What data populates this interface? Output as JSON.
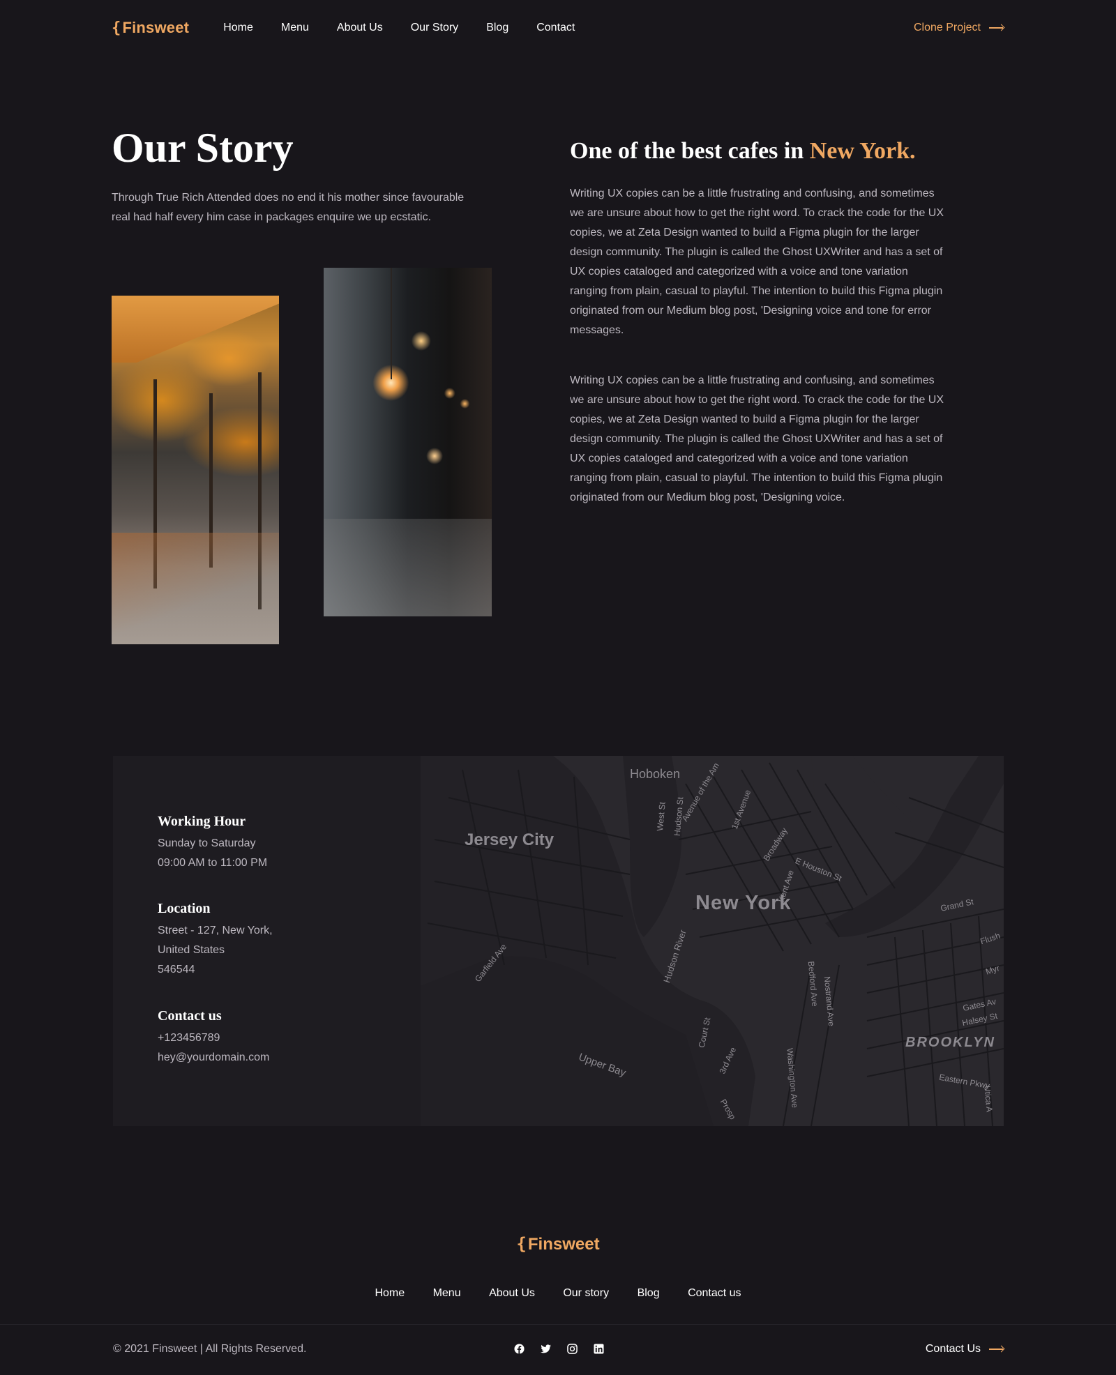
{
  "brand": {
    "name": "Finsweet",
    "brace": "{",
    "accent_color": "#f0a862"
  },
  "header": {
    "nav": [
      "Home",
      "Menu",
      "About Us",
      "Our Story",
      "Blog",
      "Contact"
    ],
    "cta": "Clone Project"
  },
  "story": {
    "title": "Our Story",
    "intro": "Through True Rich Attended does no end it his mother since favourable real had half every him case in packages enquire we up ecstatic."
  },
  "feature": {
    "title_prefix": "One of the best cafes in ",
    "title_accent": "New York.",
    "paragraph1": "Writing UX copies can be a little frustrating and confusing, and sometimes we are unsure about how to get the right word. To crack the code for the UX copies, we at Zeta Design wanted to build a Figma plugin for the larger design community. The plugin is called the Ghost UXWriter and has a set of UX copies cataloged and categorized with a voice and tone variation ranging from plain, casual to playful. The intention to build this Figma plugin originated from our Medium blog post, 'Designing voice and tone for error messages.",
    "paragraph2": "Writing UX copies can be a little frustrating and confusing, and sometimes we are unsure about how to get the right word. To crack the code for the UX copies, we at Zeta Design wanted to build a Figma plugin for the larger design community. The plugin is called the Ghost UXWriter and has a set of UX copies cataloged and categorized with a voice and tone variation ranging from plain, casual to playful. The intention to build this Figma plugin originated from our Medium blog post, 'Designing voice."
  },
  "info": {
    "working": {
      "title": "Working Hour",
      "days": "Sunday to Saturday",
      "hours": "09:00 AM to 11:00 PM"
    },
    "location": {
      "title": "Location",
      "line1": "Street - 127, New York,",
      "line2": "United States",
      "line3": "546544"
    },
    "contact": {
      "title": "Contact us",
      "phone": "+123456789",
      "email": "hey@yourdomain.com"
    }
  },
  "map": {
    "labels": {
      "hoboken": "Hoboken",
      "jersey_city": "Jersey City",
      "new_york": "New York",
      "brooklyn": "BROOKLYN",
      "hudson_river": "Hudson River",
      "upper_bay": "Upper Bay",
      "grand_st": "Grand St",
      "e_houston": "E Houston St",
      "broadway": "Broadway",
      "kent_ave": "Kent Ave",
      "garfield_ave": "Garfield Ave",
      "court_st": "Court St",
      "third_ave": "3rd Ave",
      "bedford_ave": "Bedford Ave",
      "nostrand_ave": "Nostrand Ave",
      "gates_av": "Gates Av",
      "halsey_st": "Halsey St",
      "eastern_pkwy": "Eastern Pkwy",
      "washington_ave": "Washington Ave",
      "west_st": "West St",
      "hudson_st": "Hudson St",
      "avenue_americas": "Avenue of the Am",
      "first_avenue": "1st Avenue",
      "flush": "Flush",
      "myr": "Myr",
      "utica": "Utica A",
      "prosp": "Prosp"
    }
  },
  "footer": {
    "nav": [
      "Home",
      "Menu",
      "About Us",
      "Our story",
      "Blog",
      "Contact us"
    ],
    "copyright": "© 2021 Finsweet | All Rights Reserved.",
    "cta": "Contact Us",
    "socials": [
      "facebook-icon",
      "twitter-icon",
      "instagram-icon",
      "linkedin-icon"
    ]
  }
}
